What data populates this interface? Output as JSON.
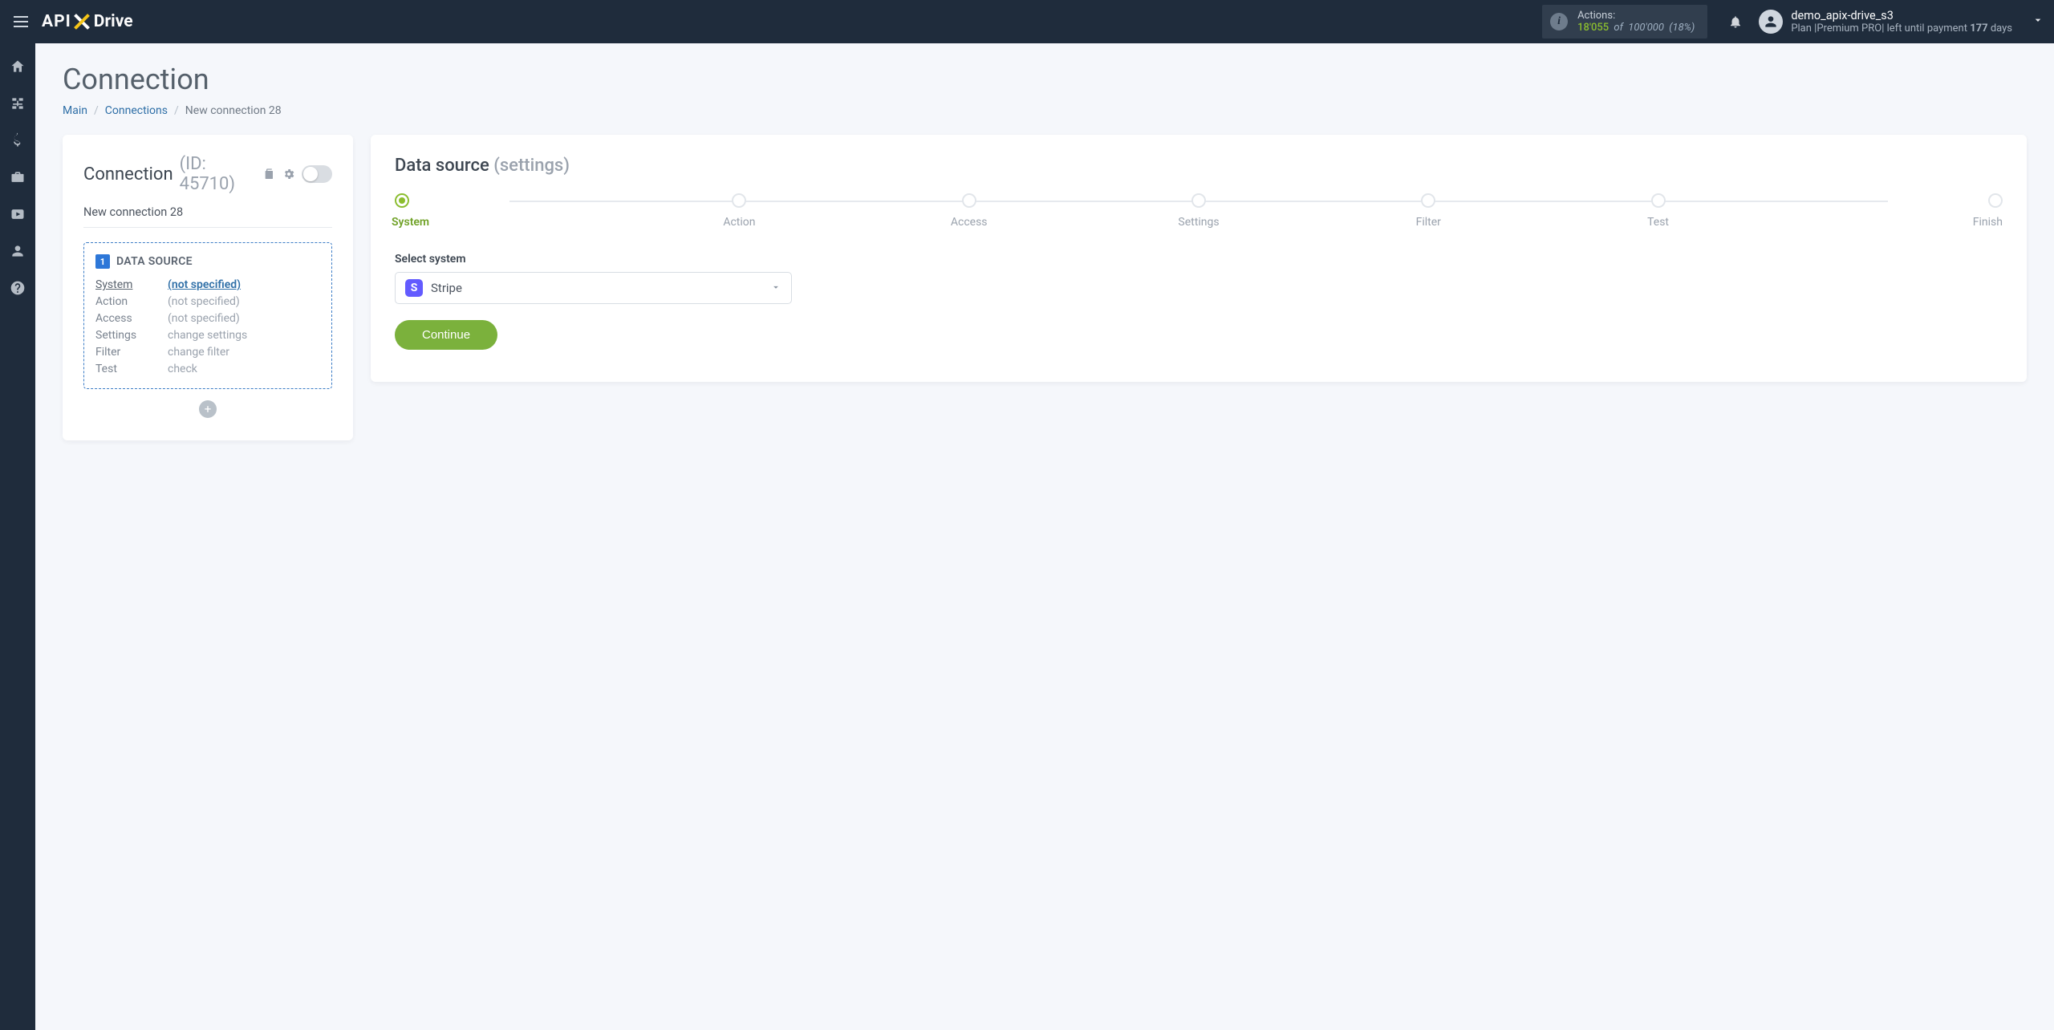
{
  "topbar": {
    "logo_api": "API",
    "logo_drive": "Drive",
    "actions": {
      "label": "Actions:",
      "used": "18'055",
      "of": "of",
      "limit": "100'000",
      "percent": "(18%)"
    },
    "user": {
      "name": "demo_apix-drive_s3",
      "plan_prefix": "Plan |",
      "plan_name": "Premium PRO",
      "plan_mid": "| left until payment ",
      "days": "177",
      "plan_suffix": " days"
    }
  },
  "page": {
    "title": "Connection",
    "breadcrumb": {
      "main": "Main",
      "connections": "Connections",
      "current": "New connection 28"
    }
  },
  "sideCard": {
    "title": "Connection",
    "idLabel": "(ID: 45710)",
    "connectionName": "New connection 28",
    "dataSourceHeading": "DATA SOURCE",
    "rows": [
      {
        "k": "System",
        "v": "(not specified)",
        "activeK": true,
        "link": true
      },
      {
        "k": "Action",
        "v": "(not specified)",
        "activeK": false,
        "link": false
      },
      {
        "k": "Access",
        "v": "(not specified)",
        "activeK": false,
        "link": false
      },
      {
        "k": "Settings",
        "v": "change settings",
        "activeK": false,
        "link": false
      },
      {
        "k": "Filter",
        "v": "change filter",
        "activeK": false,
        "link": false
      },
      {
        "k": "Test",
        "v": "check",
        "activeK": false,
        "link": false
      }
    ]
  },
  "mainCard": {
    "title": "Data source",
    "subtitle": "(settings)",
    "steps": [
      "System",
      "Action",
      "Access",
      "Settings",
      "Filter",
      "Test",
      "Finish"
    ],
    "activeStepIndex": 0,
    "selectLabel": "Select system",
    "selectedSystem": "Stripe",
    "continueLabel": "Continue"
  }
}
